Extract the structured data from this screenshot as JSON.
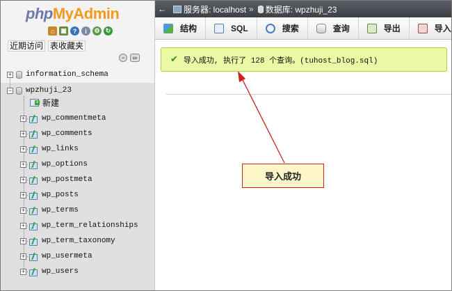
{
  "logo": {
    "php": "php",
    "my": "My",
    "admin": "Admin"
  },
  "sidebar": {
    "tabs": [
      "近期访问",
      "表收藏夹"
    ],
    "databases": [
      {
        "name": "information_schema",
        "expanded": false
      },
      {
        "name": "wpzhuji_23",
        "expanded": true
      }
    ],
    "new_label": "新建",
    "tables": [
      "wp_commentmeta",
      "wp_comments",
      "wp_links",
      "wp_options",
      "wp_postmeta",
      "wp_posts",
      "wp_terms",
      "wp_term_relationships",
      "wp_term_taxonomy",
      "wp_usermeta",
      "wp_users"
    ]
  },
  "breadcrumb": {
    "server_label": "服务器: localhost",
    "separator": "»",
    "db_label": "数据库: wpzhuji_23"
  },
  "toolbar": {
    "structure": "结构",
    "sql": "SQL",
    "search": "搜索",
    "query": "查询",
    "export": "导出",
    "import": "导入"
  },
  "message": "导入成功, 执行了 128 个查询。(tuhost_blog.sql)",
  "annotation": "导入成功",
  "colors": {
    "success_bg": "#ebf8a4",
    "success_border": "#a2d246",
    "arrow": "#cc2222",
    "callout_bg": "#fcf6c9"
  }
}
